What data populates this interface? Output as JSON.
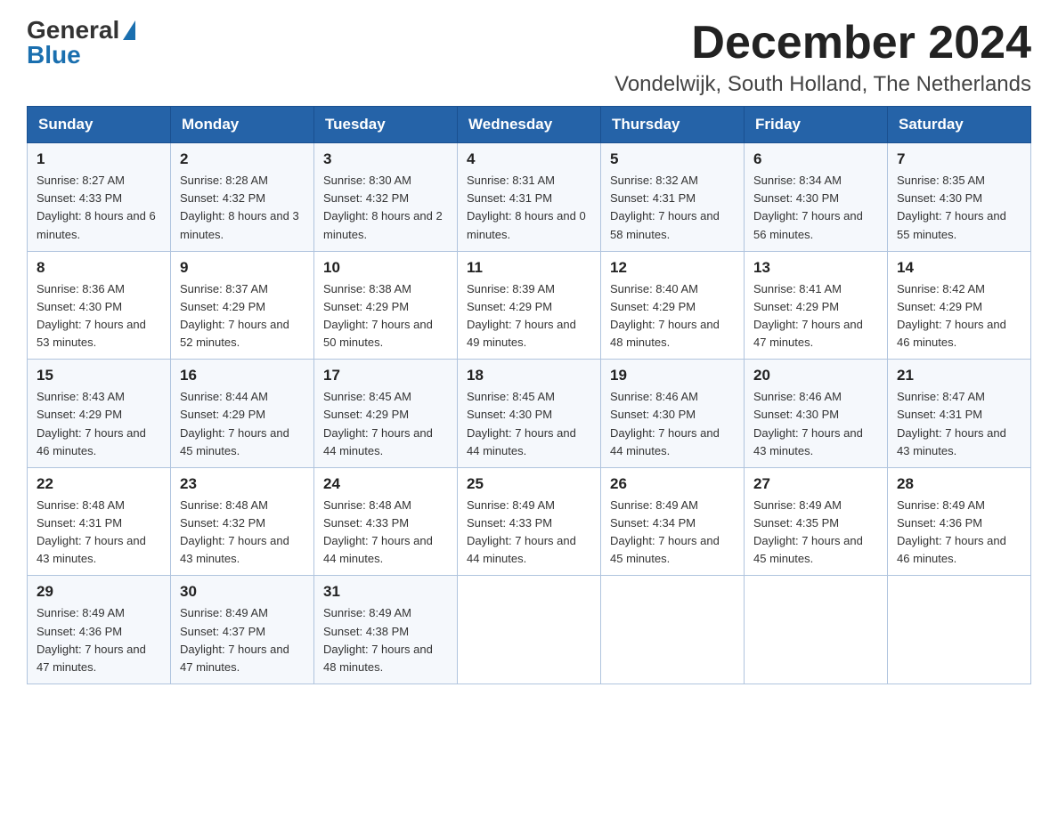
{
  "logo": {
    "general": "General",
    "blue": "Blue"
  },
  "title": "December 2024",
  "subtitle": "Vondelwijk, South Holland, The Netherlands",
  "headers": [
    "Sunday",
    "Monday",
    "Tuesday",
    "Wednesday",
    "Thursday",
    "Friday",
    "Saturday"
  ],
  "weeks": [
    [
      {
        "day": "1",
        "sunrise": "Sunrise: 8:27 AM",
        "sunset": "Sunset: 4:33 PM",
        "daylight": "Daylight: 8 hours and 6 minutes."
      },
      {
        "day": "2",
        "sunrise": "Sunrise: 8:28 AM",
        "sunset": "Sunset: 4:32 PM",
        "daylight": "Daylight: 8 hours and 3 minutes."
      },
      {
        "day": "3",
        "sunrise": "Sunrise: 8:30 AM",
        "sunset": "Sunset: 4:32 PM",
        "daylight": "Daylight: 8 hours and 2 minutes."
      },
      {
        "day": "4",
        "sunrise": "Sunrise: 8:31 AM",
        "sunset": "Sunset: 4:31 PM",
        "daylight": "Daylight: 8 hours and 0 minutes."
      },
      {
        "day": "5",
        "sunrise": "Sunrise: 8:32 AM",
        "sunset": "Sunset: 4:31 PM",
        "daylight": "Daylight: 7 hours and 58 minutes."
      },
      {
        "day": "6",
        "sunrise": "Sunrise: 8:34 AM",
        "sunset": "Sunset: 4:30 PM",
        "daylight": "Daylight: 7 hours and 56 minutes."
      },
      {
        "day": "7",
        "sunrise": "Sunrise: 8:35 AM",
        "sunset": "Sunset: 4:30 PM",
        "daylight": "Daylight: 7 hours and 55 minutes."
      }
    ],
    [
      {
        "day": "8",
        "sunrise": "Sunrise: 8:36 AM",
        "sunset": "Sunset: 4:30 PM",
        "daylight": "Daylight: 7 hours and 53 minutes."
      },
      {
        "day": "9",
        "sunrise": "Sunrise: 8:37 AM",
        "sunset": "Sunset: 4:29 PM",
        "daylight": "Daylight: 7 hours and 52 minutes."
      },
      {
        "day": "10",
        "sunrise": "Sunrise: 8:38 AM",
        "sunset": "Sunset: 4:29 PM",
        "daylight": "Daylight: 7 hours and 50 minutes."
      },
      {
        "day": "11",
        "sunrise": "Sunrise: 8:39 AM",
        "sunset": "Sunset: 4:29 PM",
        "daylight": "Daylight: 7 hours and 49 minutes."
      },
      {
        "day": "12",
        "sunrise": "Sunrise: 8:40 AM",
        "sunset": "Sunset: 4:29 PM",
        "daylight": "Daylight: 7 hours and 48 minutes."
      },
      {
        "day": "13",
        "sunrise": "Sunrise: 8:41 AM",
        "sunset": "Sunset: 4:29 PM",
        "daylight": "Daylight: 7 hours and 47 minutes."
      },
      {
        "day": "14",
        "sunrise": "Sunrise: 8:42 AM",
        "sunset": "Sunset: 4:29 PM",
        "daylight": "Daylight: 7 hours and 46 minutes."
      }
    ],
    [
      {
        "day": "15",
        "sunrise": "Sunrise: 8:43 AM",
        "sunset": "Sunset: 4:29 PM",
        "daylight": "Daylight: 7 hours and 46 minutes."
      },
      {
        "day": "16",
        "sunrise": "Sunrise: 8:44 AM",
        "sunset": "Sunset: 4:29 PM",
        "daylight": "Daylight: 7 hours and 45 minutes."
      },
      {
        "day": "17",
        "sunrise": "Sunrise: 8:45 AM",
        "sunset": "Sunset: 4:29 PM",
        "daylight": "Daylight: 7 hours and 44 minutes."
      },
      {
        "day": "18",
        "sunrise": "Sunrise: 8:45 AM",
        "sunset": "Sunset: 4:30 PM",
        "daylight": "Daylight: 7 hours and 44 minutes."
      },
      {
        "day": "19",
        "sunrise": "Sunrise: 8:46 AM",
        "sunset": "Sunset: 4:30 PM",
        "daylight": "Daylight: 7 hours and 44 minutes."
      },
      {
        "day": "20",
        "sunrise": "Sunrise: 8:46 AM",
        "sunset": "Sunset: 4:30 PM",
        "daylight": "Daylight: 7 hours and 43 minutes."
      },
      {
        "day": "21",
        "sunrise": "Sunrise: 8:47 AM",
        "sunset": "Sunset: 4:31 PM",
        "daylight": "Daylight: 7 hours and 43 minutes."
      }
    ],
    [
      {
        "day": "22",
        "sunrise": "Sunrise: 8:48 AM",
        "sunset": "Sunset: 4:31 PM",
        "daylight": "Daylight: 7 hours and 43 minutes."
      },
      {
        "day": "23",
        "sunrise": "Sunrise: 8:48 AM",
        "sunset": "Sunset: 4:32 PM",
        "daylight": "Daylight: 7 hours and 43 minutes."
      },
      {
        "day": "24",
        "sunrise": "Sunrise: 8:48 AM",
        "sunset": "Sunset: 4:33 PM",
        "daylight": "Daylight: 7 hours and 44 minutes."
      },
      {
        "day": "25",
        "sunrise": "Sunrise: 8:49 AM",
        "sunset": "Sunset: 4:33 PM",
        "daylight": "Daylight: 7 hours and 44 minutes."
      },
      {
        "day": "26",
        "sunrise": "Sunrise: 8:49 AM",
        "sunset": "Sunset: 4:34 PM",
        "daylight": "Daylight: 7 hours and 45 minutes."
      },
      {
        "day": "27",
        "sunrise": "Sunrise: 8:49 AM",
        "sunset": "Sunset: 4:35 PM",
        "daylight": "Daylight: 7 hours and 45 minutes."
      },
      {
        "day": "28",
        "sunrise": "Sunrise: 8:49 AM",
        "sunset": "Sunset: 4:36 PM",
        "daylight": "Daylight: 7 hours and 46 minutes."
      }
    ],
    [
      {
        "day": "29",
        "sunrise": "Sunrise: 8:49 AM",
        "sunset": "Sunset: 4:36 PM",
        "daylight": "Daylight: 7 hours and 47 minutes."
      },
      {
        "day": "30",
        "sunrise": "Sunrise: 8:49 AM",
        "sunset": "Sunset: 4:37 PM",
        "daylight": "Daylight: 7 hours and 47 minutes."
      },
      {
        "day": "31",
        "sunrise": "Sunrise: 8:49 AM",
        "sunset": "Sunset: 4:38 PM",
        "daylight": "Daylight: 7 hours and 48 minutes."
      },
      null,
      null,
      null,
      null
    ]
  ]
}
